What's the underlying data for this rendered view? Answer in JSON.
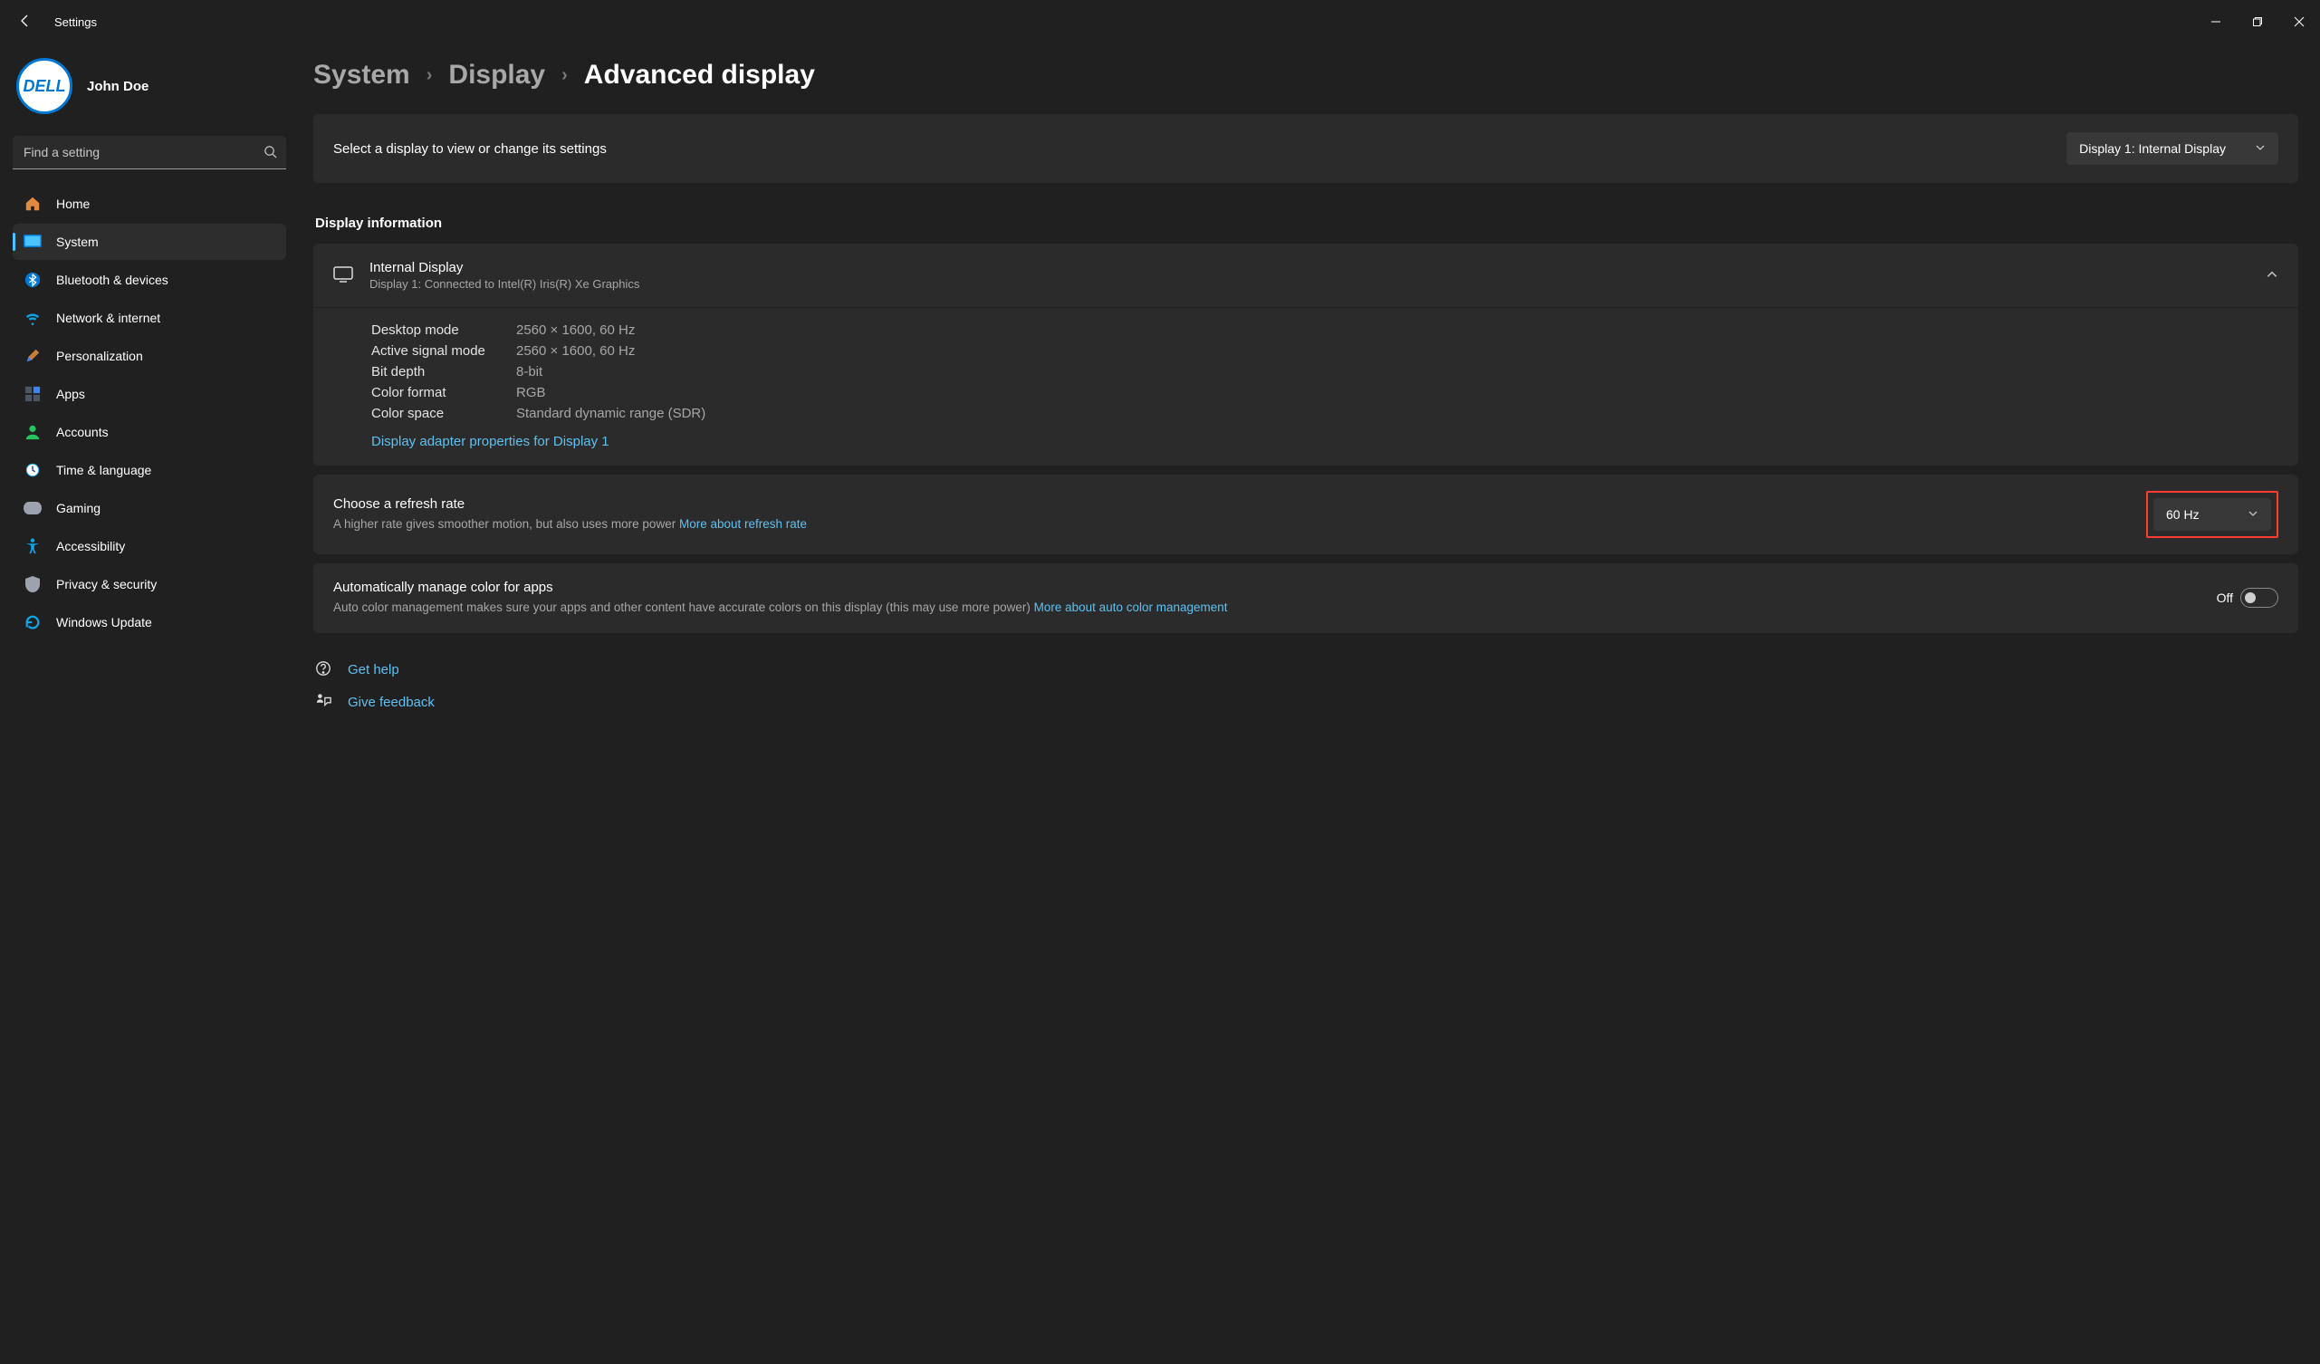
{
  "window": {
    "title": "Settings"
  },
  "profile": {
    "name": "John Doe",
    "avatar_text": "DELL"
  },
  "search": {
    "placeholder": "Find a setting"
  },
  "sidebar": {
    "items": [
      {
        "label": "Home"
      },
      {
        "label": "System"
      },
      {
        "label": "Bluetooth & devices"
      },
      {
        "label": "Network & internet"
      },
      {
        "label": "Personalization"
      },
      {
        "label": "Apps"
      },
      {
        "label": "Accounts"
      },
      {
        "label": "Time & language"
      },
      {
        "label": "Gaming"
      },
      {
        "label": "Accessibility"
      },
      {
        "label": "Privacy & security"
      },
      {
        "label": "Windows Update"
      }
    ],
    "active_index": 1
  },
  "breadcrumb": {
    "level1": "System",
    "level2": "Display",
    "current": "Advanced display"
  },
  "select_display": {
    "prompt": "Select a display to view or change its settings",
    "selected": "Display 1: Internal Display"
  },
  "section_title": "Display information",
  "display_info": {
    "name": "Internal Display",
    "subtitle": "Display 1: Connected to Intel(R) Iris(R) Xe Graphics",
    "rows": {
      "desktop_mode": {
        "label": "Desktop mode",
        "value": "2560 × 1600, 60 Hz"
      },
      "active_signal_mode": {
        "label": "Active signal mode",
        "value": "2560 × 1600, 60 Hz"
      },
      "bit_depth": {
        "label": "Bit depth",
        "value": "8-bit"
      },
      "color_format": {
        "label": "Color format",
        "value": "RGB"
      },
      "color_space": {
        "label": "Color space",
        "value": "Standard dynamic range (SDR)"
      }
    },
    "adapter_link": "Display adapter properties for Display 1"
  },
  "refresh_rate": {
    "title": "Choose a refresh rate",
    "subtitle_prefix": "A higher rate gives smoother motion, but also uses more power  ",
    "more_link": "More about refresh rate",
    "value": "60 Hz"
  },
  "auto_color": {
    "title": "Automatically manage color for apps",
    "subtitle_prefix": "Auto color management makes sure your apps and other content have accurate colors on this display (this may use more power) ",
    "more_link": "More about auto color management",
    "state_label": "Off"
  },
  "footer": {
    "help": "Get help",
    "feedback": "Give feedback"
  }
}
